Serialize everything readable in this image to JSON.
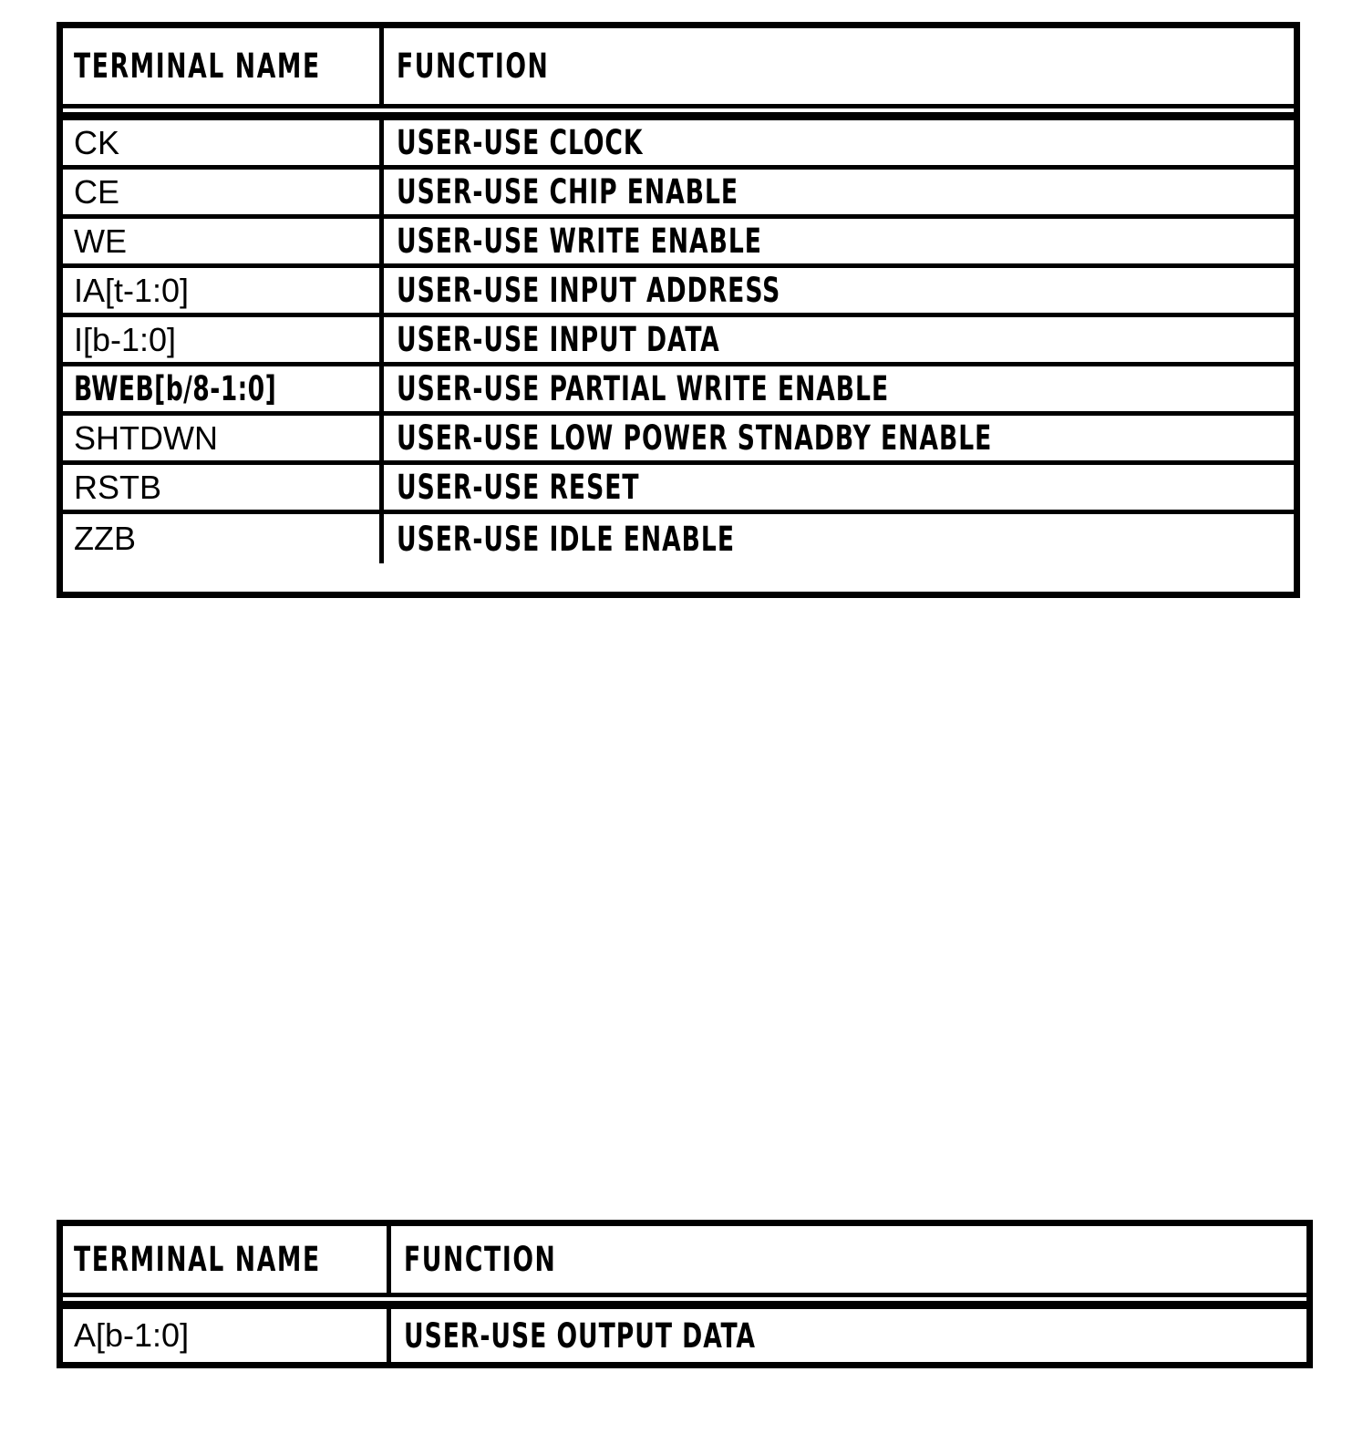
{
  "page": {
    "background_color": "#ffffff",
    "ink_color": "#000000"
  },
  "tables": [
    {
      "id": "terminal-inputs",
      "headers": {
        "name": "TERMINAL NAME",
        "function": "FUNCTION"
      },
      "rows": [
        {
          "name": "CK",
          "function": "USER-USE CLOCK"
        },
        {
          "name": "CE",
          "function": "USER-USE CHIP ENABLE"
        },
        {
          "name": "WE",
          "function": "USER-USE WRITE ENABLE"
        },
        {
          "name": "IA[t-1:0]",
          "function": "USER-USE INPUT ADDRESS"
        },
        {
          "name": "I[b-1:0]",
          "function": "USER-USE INPUT DATA"
        },
        {
          "name": "BWEB[b/8-1:0]",
          "function": "USER-USE PARTIAL WRITE ENABLE"
        },
        {
          "name": "SHTDWN",
          "function": "USER-USE LOW POWER STNADBY ENABLE"
        },
        {
          "name": "RSTB",
          "function": "USER-USE RESET"
        },
        {
          "name": "ZZB",
          "function": "USER-USE IDLE ENABLE"
        }
      ]
    },
    {
      "id": "terminal-outputs",
      "headers": {
        "name": "TERMINAL NAME",
        "function": "FUNCTION"
      },
      "rows": [
        {
          "name": "A[b-1:0]",
          "function": "USER-USE OUTPUT DATA"
        }
      ]
    }
  ]
}
